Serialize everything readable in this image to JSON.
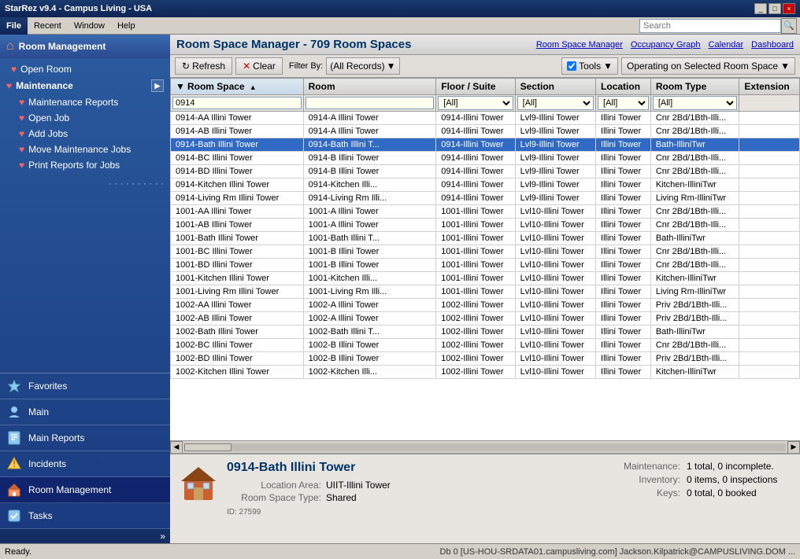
{
  "titleBar": {
    "title": "StarRez v9.4 - Campus Living - USA",
    "controls": [
      "_",
      "□",
      "×"
    ]
  },
  "menuBar": {
    "fileLabel": "File",
    "items": [
      "Recent",
      "Window",
      "Help"
    ],
    "search": {
      "placeholder": "Search",
      "buttonLabel": "🔍"
    }
  },
  "sidebar": {
    "header": "Room Management",
    "items": [
      {
        "label": "Open Room",
        "icon": "heart"
      },
      {
        "label": "Maintenance",
        "icon": "heart",
        "expandable": true
      },
      {
        "label": "Maintenance Reports",
        "icon": "heart",
        "indent": true
      },
      {
        "label": "Open Job",
        "icon": "heart",
        "indent": true
      },
      {
        "label": "Add Jobs",
        "icon": "heart",
        "indent": true
      },
      {
        "label": "Move Maintenance Jobs",
        "icon": "heart",
        "indent": true
      },
      {
        "label": "Print Reports for Jobs",
        "icon": "heart",
        "indent": true
      }
    ],
    "nav": [
      {
        "label": "Favorites",
        "icon": "star",
        "active": false
      },
      {
        "label": "Main",
        "icon": "person",
        "active": false
      },
      {
        "label": "Main Reports",
        "icon": "report",
        "active": false
      },
      {
        "label": "Incidents",
        "icon": "alert",
        "active": false
      },
      {
        "label": "Room Management",
        "icon": "room",
        "active": true
      },
      {
        "label": "Tasks",
        "icon": "task",
        "active": false
      }
    ]
  },
  "content": {
    "title": "Room Space Manager - 709 Room Spaces",
    "headerLinks": [
      "Room Space Manager",
      "Occupancy Graph",
      "Calendar",
      "Dashboard"
    ],
    "toolbar": {
      "refreshLabel": "Refresh",
      "clearLabel": "Clear",
      "filterByLabel": "Filter By:",
      "filterValue": "(All Records)",
      "toolsLabel": "Tools",
      "operatingLabel": "Operating on Selected Room Space"
    },
    "columns": [
      {
        "label": "Room Space",
        "sortable": true
      },
      {
        "label": "Room"
      },
      {
        "label": "Floor / Suite"
      },
      {
        "label": "Section"
      },
      {
        "label": "Location"
      },
      {
        "label": "Room Type"
      },
      {
        "label": "Extension"
      }
    ],
    "filters": {
      "floorSuite": "[All]",
      "section": "[All]",
      "location": "[All]",
      "roomType": "[All]"
    },
    "rows": [
      {
        "id": 1,
        "roomSpace": "0914",
        "room": "",
        "floorSuite": "",
        "section": "",
        "location": "",
        "roomType": "",
        "extension": "",
        "selected": false,
        "isInput": true
      },
      {
        "id": 2,
        "roomSpace": "0914-AA Illini Tower",
        "room": "0914-A Illini Tower",
        "floorSuite": "0914-Illini Tower",
        "section": "Lvl9-Illini Tower",
        "location": "Illini Tower",
        "roomType": "Cnr 2Bd/1Bth-Illi...",
        "extension": "",
        "selected": false
      },
      {
        "id": 3,
        "roomSpace": "0914-AB Illini Tower",
        "room": "0914-A Illini Tower",
        "floorSuite": "0914-Illini Tower",
        "section": "Lvl9-Illini Tower",
        "location": "Illini Tower",
        "roomType": "Cnr 2Bd/1Bth-Illi...",
        "extension": "",
        "selected": false
      },
      {
        "id": 4,
        "roomSpace": "0914-Bath Illini Tower",
        "room": "0914-Bath Illini T...",
        "floorSuite": "0914-Illini Tower",
        "section": "Lvl9-Illini Tower",
        "location": "Illini Tower",
        "roomType": "Bath-IlliniTwr",
        "extension": "",
        "selected": true
      },
      {
        "id": 5,
        "roomSpace": "0914-BC Illini Tower",
        "room": "0914-B Illini Tower",
        "floorSuite": "0914-Illini Tower",
        "section": "Lvl9-Illini Tower",
        "location": "Illini Tower",
        "roomType": "Cnr 2Bd/1Bth-Illi...",
        "extension": "",
        "selected": false
      },
      {
        "id": 6,
        "roomSpace": "0914-BD Illini Tower",
        "room": "0914-B Illini Tower",
        "floorSuite": "0914-Illini Tower",
        "section": "Lvl9-Illini Tower",
        "location": "Illini Tower",
        "roomType": "Cnr 2Bd/1Bth-Illi...",
        "extension": "",
        "selected": false
      },
      {
        "id": 7,
        "roomSpace": "0914-Kitchen Illini Tower",
        "room": "0914-Kitchen Illi...",
        "floorSuite": "0914-Illini Tower",
        "section": "Lvl9-Illini Tower",
        "location": "Illini Tower",
        "roomType": "Kitchen-IlliniTwr",
        "extension": "",
        "selected": false
      },
      {
        "id": 8,
        "roomSpace": "0914-Living Rm Illini Tower",
        "room": "0914-Living Rm Illi...",
        "floorSuite": "0914-Illini Tower",
        "section": "Lvl9-Illini Tower",
        "location": "Illini Tower",
        "roomType": "Living Rm-IlliniTwr",
        "extension": "",
        "selected": false
      },
      {
        "id": 9,
        "roomSpace": "1001-AA Illini Tower",
        "room": "1001-A Illini Tower",
        "floorSuite": "1001-Illini Tower",
        "section": "Lvl10-Illini Tower",
        "location": "Illini Tower",
        "roomType": "Cnr 2Bd/1Bth-Illi...",
        "extension": "",
        "selected": false
      },
      {
        "id": 10,
        "roomSpace": "1001-AB Illini Tower",
        "room": "1001-A Illini Tower",
        "floorSuite": "1001-Illini Tower",
        "section": "Lvl10-Illini Tower",
        "location": "Illini Tower",
        "roomType": "Cnr 2Bd/1Bth-Illi...",
        "extension": "",
        "selected": false
      },
      {
        "id": 11,
        "roomSpace": "1001-Bath Illini Tower",
        "room": "1001-Bath Illini T...",
        "floorSuite": "1001-Illini Tower",
        "section": "Lvl10-Illini Tower",
        "location": "Illini Tower",
        "roomType": "Bath-IlliniTwr",
        "extension": "",
        "selected": false
      },
      {
        "id": 12,
        "roomSpace": "1001-BC Illini Tower",
        "room": "1001-B Illini Tower",
        "floorSuite": "1001-Illini Tower",
        "section": "Lvl10-Illini Tower",
        "location": "Illini Tower",
        "roomType": "Cnr 2Bd/1Bth-Illi...",
        "extension": "",
        "selected": false
      },
      {
        "id": 13,
        "roomSpace": "1001-BD Illini Tower",
        "room": "1001-B Illini Tower",
        "floorSuite": "1001-Illini Tower",
        "section": "Lvl10-Illini Tower",
        "location": "Illini Tower",
        "roomType": "Cnr 2Bd/1Bth-Illi...",
        "extension": "",
        "selected": false
      },
      {
        "id": 14,
        "roomSpace": "1001-Kitchen Illini Tower",
        "room": "1001-Kitchen Illi...",
        "floorSuite": "1001-Illini Tower",
        "section": "Lvl10-Illini Tower",
        "location": "Illini Tower",
        "roomType": "Kitchen-IlliniTwr",
        "extension": "",
        "selected": false
      },
      {
        "id": 15,
        "roomSpace": "1001-Living Rm Illini Tower",
        "room": "1001-Living Rm Illi...",
        "floorSuite": "1001-Illini Tower",
        "section": "Lvl10-Illini Tower",
        "location": "Illini Tower",
        "roomType": "Living Rm-IlliniTwr",
        "extension": "",
        "selected": false
      },
      {
        "id": 16,
        "roomSpace": "1002-AA Illini Tower",
        "room": "1002-A Illini Tower",
        "floorSuite": "1002-Illini Tower",
        "section": "Lvl10-Illini Tower",
        "location": "Illini Tower",
        "roomType": "Priv 2Bd/1Bth-Illi...",
        "extension": "",
        "selected": false
      },
      {
        "id": 17,
        "roomSpace": "1002-AB Illini Tower",
        "room": "1002-A Illini Tower",
        "floorSuite": "1002-Illini Tower",
        "section": "Lvl10-Illini Tower",
        "location": "Illini Tower",
        "roomType": "Priv 2Bd/1Bth-Illi...",
        "extension": "",
        "selected": false
      },
      {
        "id": 18,
        "roomSpace": "1002-Bath Illini Tower",
        "room": "1002-Bath Illini T...",
        "floorSuite": "1002-Illini Tower",
        "section": "Lvl10-Illini Tower",
        "location": "Illini Tower",
        "roomType": "Bath-IlliniTwr",
        "extension": "",
        "selected": false
      },
      {
        "id": 19,
        "roomSpace": "1002-BC Illini Tower",
        "room": "1002-B Illini Tower",
        "floorSuite": "1002-Illini Tower",
        "section": "Lvl10-Illini Tower",
        "location": "Illini Tower",
        "roomType": "Cnr 2Bd/1Bth-Illi...",
        "extension": "",
        "selected": false
      },
      {
        "id": 20,
        "roomSpace": "1002-BD Illini Tower",
        "room": "1002-B Illini Tower",
        "floorSuite": "1002-Illini Tower",
        "section": "Lvl10-Illini Tower",
        "location": "Illini Tower",
        "roomType": "Priv 2Bd/1Bth-Illi...",
        "extension": "",
        "selected": false
      },
      {
        "id": 21,
        "roomSpace": "1002-Kitchen Illini Tower",
        "room": "1002-Kitchen Illi...",
        "floorSuite": "1002-Illini Tower",
        "section": "Lvl10-Illini Tower",
        "location": "Illini Tower",
        "roomType": "Kitchen-IlliniTwr",
        "extension": "",
        "selected": false
      }
    ],
    "detail": {
      "title": "0914-Bath Illini Tower",
      "locationAreaLabel": "Location Area:",
      "locationAreaValue": "UIIT-Illini Tower",
      "roomSpaceTypeLabel": "Room Space Type:",
      "roomSpaceTypeValue": "Shared",
      "maintenanceLabel": "Maintenance:",
      "maintenanceValue": "1 total, 0 incomplete.",
      "inventoryLabel": "Inventory:",
      "inventoryValue": "0 items, 0 inspections",
      "keysLabel": "Keys:",
      "keysValue": "0 total, 0 booked",
      "idLabel": "ID: 27599"
    }
  },
  "statusBar": {
    "leftText": "Ready.",
    "rightText": "Db 0 [US-HOU-SRDATA01.campusliving.com]  Jackson.Kilpatrick@CAMPUSLIVING.DOM ..."
  }
}
